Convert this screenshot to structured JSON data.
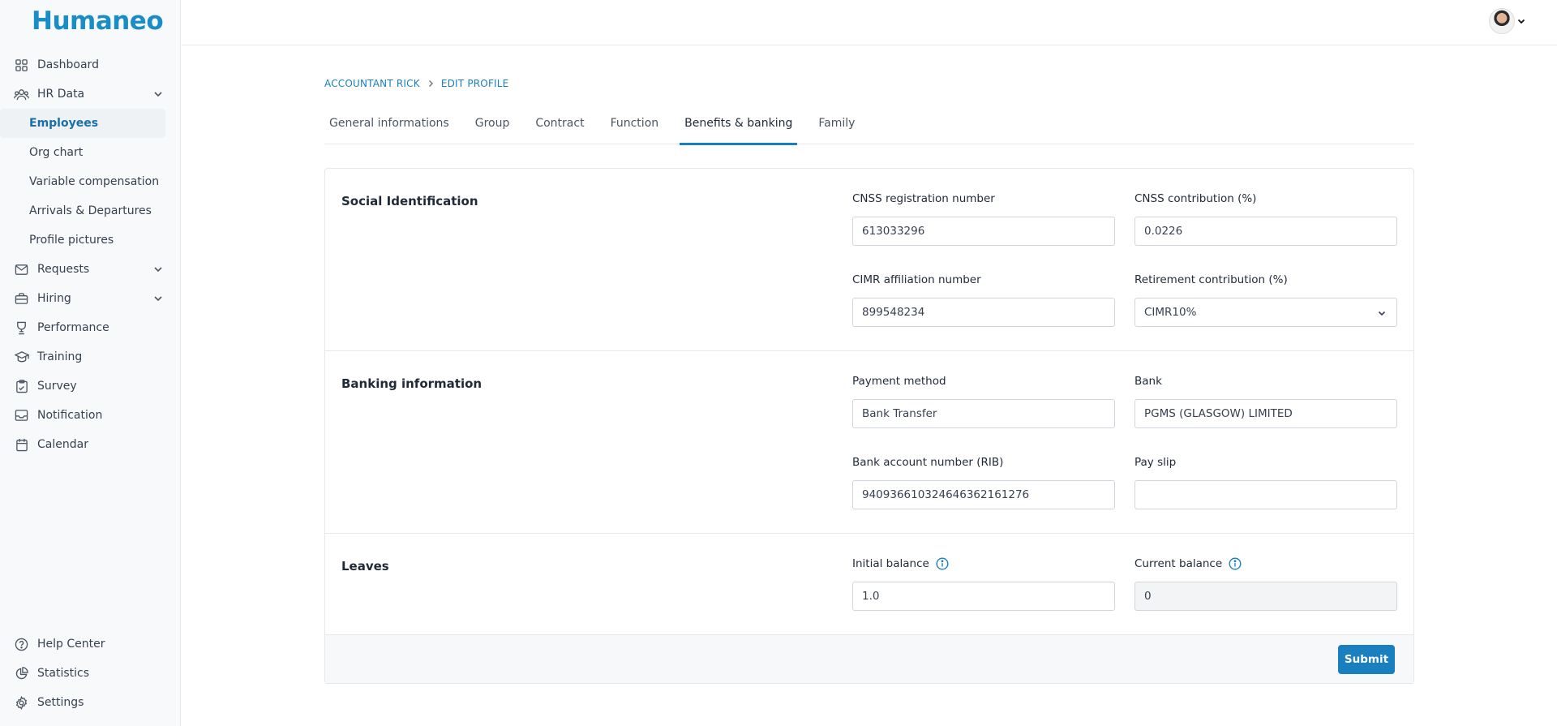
{
  "app": {
    "logo": "Humaneo"
  },
  "sidebar": {
    "items": [
      {
        "label": "Dashboard",
        "icon": "grid-icon"
      },
      {
        "label": "HR Data",
        "icon": "users-icon",
        "expanded": true,
        "children": [
          {
            "label": "Employees",
            "active": true
          },
          {
            "label": "Org chart"
          },
          {
            "label": "Variable compensation"
          },
          {
            "label": "Arrivals & Departures"
          },
          {
            "label": "Profile pictures"
          }
        ]
      },
      {
        "label": "Requests",
        "icon": "mail-icon"
      },
      {
        "label": "Hiring",
        "icon": "briefcase-icon"
      },
      {
        "label": "Performance",
        "icon": "trophy-icon"
      },
      {
        "label": "Training",
        "icon": "graduation-icon"
      },
      {
        "label": "Survey",
        "icon": "clipboard-icon"
      },
      {
        "label": "Notification",
        "icon": "inbox-icon"
      },
      {
        "label": "Calendar",
        "icon": "calendar-icon"
      }
    ],
    "bottom": [
      {
        "label": "Help Center",
        "icon": "help-icon"
      },
      {
        "label": "Statistics",
        "icon": "pie-chart-icon"
      },
      {
        "label": "Settings",
        "icon": "gear-icon"
      }
    ]
  },
  "breadcrumb": {
    "parent": "ACCOUNTANT RICK",
    "current": "EDIT PROFILE"
  },
  "tabs": [
    {
      "label": "General informations"
    },
    {
      "label": "Group"
    },
    {
      "label": "Contract"
    },
    {
      "label": "Function"
    },
    {
      "label": "Benefits & banking",
      "active": true
    },
    {
      "label": "Family"
    }
  ],
  "social": {
    "title": "Social Identification",
    "cnss_number_label": "CNSS registration number",
    "cnss_number_value": "613033296",
    "cnss_contribution_label": "CNSS contribution (%)",
    "cnss_contribution_value": "0.0226",
    "cimr_label": "CIMR affiliation number",
    "cimr_value": "899548234",
    "retirement_label": "Retirement contribution (%)",
    "retirement_value": "CIMR10%"
  },
  "banking": {
    "title": "Banking information",
    "payment_method_label": "Payment method",
    "payment_method_value": "Bank Transfer",
    "bank_label": "Bank",
    "bank_value": "PGMS (GLASGOW) LIMITED",
    "rib_label": "Bank account number (RIB)",
    "rib_value": "940936610324646362161276",
    "payslip_label": "Pay slip",
    "payslip_value": ""
  },
  "leaves": {
    "title": "Leaves",
    "initial_label": "Initial balance",
    "initial_value": "1.0",
    "current_label": "Current balance",
    "current_value": "0"
  },
  "form": {
    "submit_label": "Submit"
  },
  "colors": {
    "brand": "#1a8dc7",
    "accent": "#1a7fbf"
  }
}
